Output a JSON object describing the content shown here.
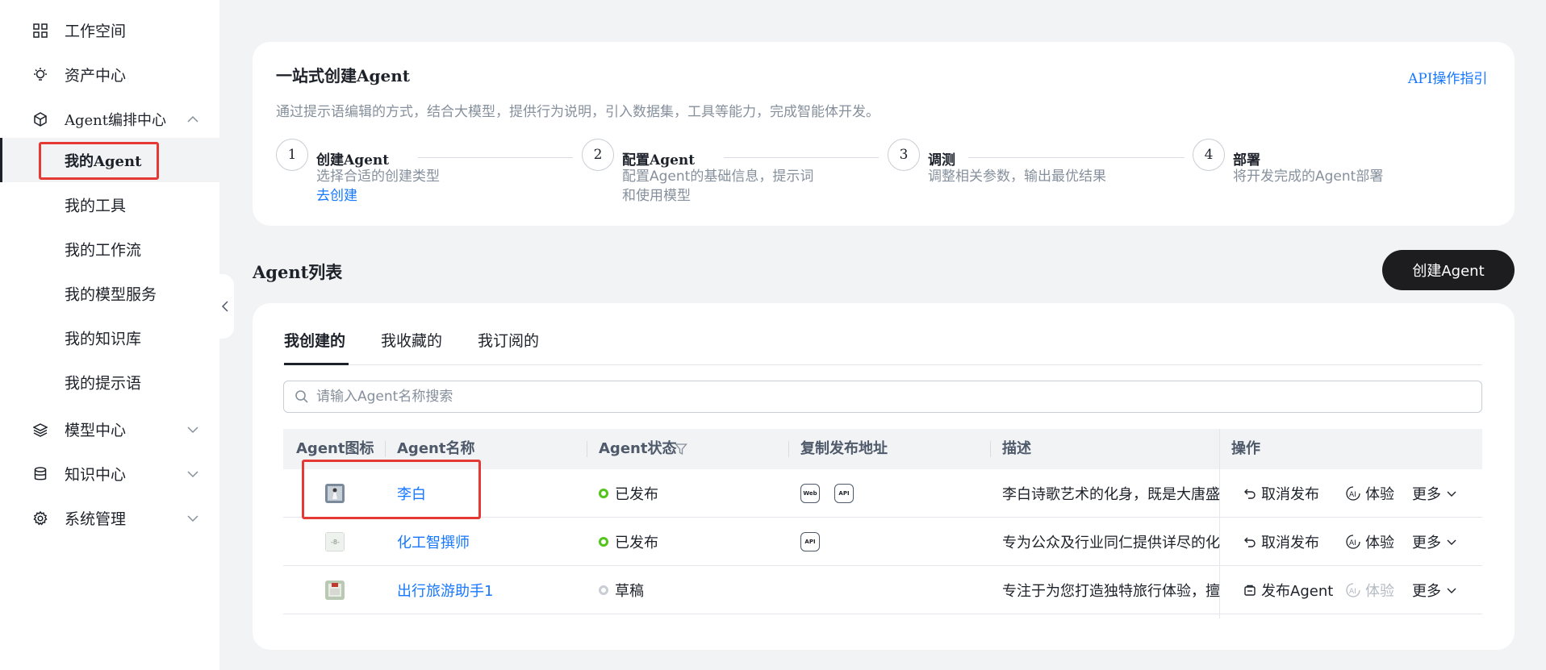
{
  "sidebar": {
    "workspace": "工作空间",
    "assets": "资产中心",
    "agent_center": "Agent编排中心",
    "agent_sub": [
      "我的Agent",
      "我的工具",
      "我的工作流",
      "我的模型服务",
      "我的知识库",
      "我的提示语"
    ],
    "model_center": "模型中心",
    "knowledge_center": "知识中心",
    "system": "系统管理"
  },
  "guide": {
    "title": "一站式创建Agent",
    "api_link": "API操作指引",
    "subtitle": "通过提示语编辑的方式，结合大模型，提供行为说明，引入数据集，工具等能力，完成智能体开发。",
    "steps": [
      {
        "num": "1",
        "title": "创建Agent",
        "desc1": "选择合适的创建类型",
        "desc2": "",
        "link": "去创建"
      },
      {
        "num": "2",
        "title": "配置Agent",
        "desc1": "配置Agent的基础信息，提示词",
        "desc2": "和使用模型",
        "link": ""
      },
      {
        "num": "3",
        "title": "调测",
        "desc1": "调整相关参数，输出最优结果",
        "desc2": "",
        "link": ""
      },
      {
        "num": "4",
        "title": "部署",
        "desc1": "将开发完成的Agent部署",
        "desc2": "",
        "link": ""
      }
    ]
  },
  "list": {
    "title": "Agent列表",
    "create_button": "创建Agent",
    "tabs": [
      "我创建的",
      "我收藏的",
      "我订阅的"
    ],
    "active_tab": 0,
    "search_placeholder": "请输入Agent名称搜索",
    "columns": [
      "Agent图标",
      "Agent名称",
      "Agent状态",
      "复制发布地址",
      "描述",
      "操作"
    ],
    "rows": [
      {
        "name": "李白",
        "status": "已发布",
        "status_type": "published",
        "badges": [
          "Web",
          "API"
        ],
        "desc": "李白诗歌艺术的化身，既是大唐盛",
        "op1": "取消发布",
        "op2": "体验",
        "op2_enabled": true,
        "op3": "更多"
      },
      {
        "name": "化工智撰师",
        "status": "已发布",
        "status_type": "published",
        "badges": [
          "API"
        ],
        "desc": "专为公众及行业同仁提供详尽的化",
        "op1": "取消发布",
        "op2": "体验",
        "op2_enabled": true,
        "op3": "更多"
      },
      {
        "name": "出行旅游助手1",
        "status": "草稿",
        "status_type": "draft",
        "badges": [],
        "desc": "专注于为您打造独特旅行体验，擅",
        "op1": "发布Agent",
        "op2": "体验",
        "op2_enabled": false,
        "op3": "更多"
      }
    ]
  },
  "colors": {
    "accent": "#1677ff",
    "published": "#52c41a",
    "highlight": "#e53935"
  }
}
